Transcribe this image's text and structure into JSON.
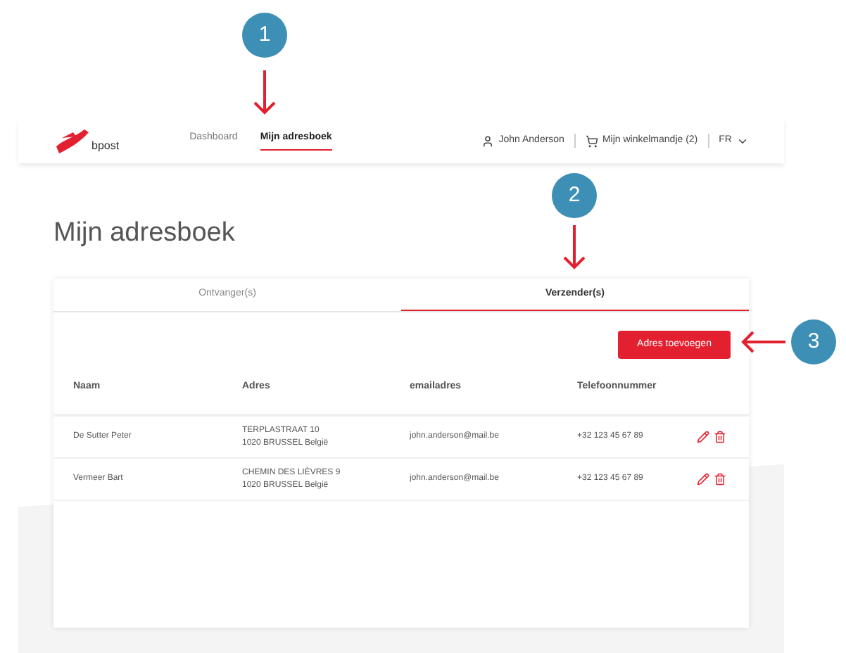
{
  "logo": "bpost",
  "nav": {
    "items": [
      {
        "label": "Dashboard",
        "selected": false
      },
      {
        "label": "Mijn adresboek",
        "selected": true
      }
    ],
    "user": "John Anderson",
    "cart": "Mijn winkelmandje (2)",
    "language": "FR"
  },
  "title": "Mijn adresboek",
  "tabs": [
    {
      "label": "Ontvanger(s)",
      "selected": false
    },
    {
      "label": "Verzender(s)",
      "selected": true
    }
  ],
  "add_button": "Adres toevoegen",
  "table": {
    "columns": [
      "Naam",
      "Adres",
      "emailadres",
      "Telefoonnummer"
    ],
    "rows": [
      {
        "name": "De Sutter Peter",
        "address_line_1": "TERPLASTRAAT 10",
        "address_line_2": "1020 BRUSSEL België",
        "email": "john.anderson@mail.be",
        "phone": "+32 123 45 67 89"
      },
      {
        "name": "Vermeer Bart",
        "address_line_1": "CHEMIN DES LIÈVRES 9",
        "address_line_2": "1020 BRUSSEL België",
        "email": "john.anderson@mail.be",
        "phone": "+32 123 45 67 89"
      }
    ]
  },
  "callouts": [
    "1",
    "2",
    "3"
  ]
}
